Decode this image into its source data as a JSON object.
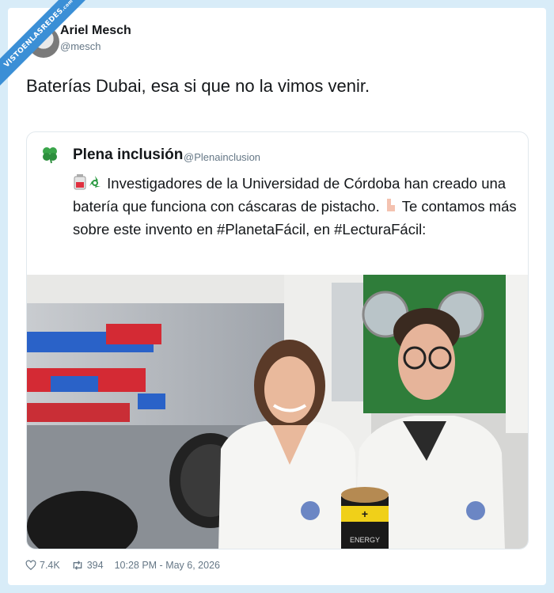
{
  "watermark": {
    "text": "VISTOENLASREDES",
    "suffix": ".com"
  },
  "tweet": {
    "author_name": "Ariel Mesch",
    "author_handle": "@mesch",
    "text": "Baterías Dubai, esa si que no la vimos venir.",
    "likes": "7.4K",
    "retweets": "394",
    "timestamp": "10:28 PM - May 6, 2026"
  },
  "quoted": {
    "author_name": "Plena inclusión",
    "author_handle": "@Plenainclusion",
    "text_part1": "Investigadores de la Universidad de Córdoba han creado una batería que funciona con cáscaras de pistacho.",
    "text_part2": "Te contamos más sobre este invento en #PlanetaFácil, en #LecturaFácil:",
    "battery_label": "ENERGY",
    "battery_plus": "+"
  },
  "colors": {
    "accent": "#3b8fd6",
    "text": "#14171a",
    "muted": "#657786",
    "logo_green": "#3aa54a"
  }
}
